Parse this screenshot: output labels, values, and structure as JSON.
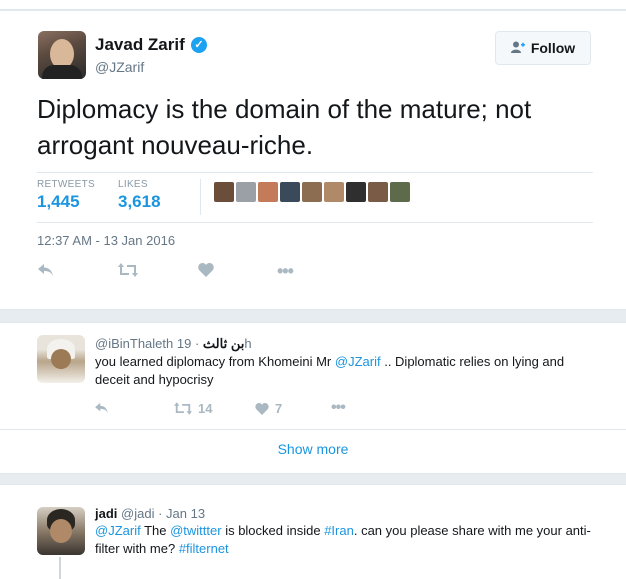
{
  "main_tweet": {
    "author_name": "Javad Zarif",
    "author_handle": "@JZarif",
    "follow_label": "Follow",
    "text": "Diplomacy is the domain of the mature; not arrogant nouveau-riche.",
    "retweets_label": "RETWEETS",
    "retweets_count": "1,445",
    "likes_label": "LIKES",
    "likes_count": "3,618",
    "timestamp": "12:37 AM - 13 Jan 2016",
    "icons": [
      "reply-icon",
      "retweet-icon",
      "like-icon",
      "more-icon",
      "verified-icon",
      "follow-person-icon"
    ]
  },
  "reply_1": {
    "handle": "@iBinThaleth",
    "arabic_name": "بن ثالث",
    "time": "· 19h",
    "text_prefix": "you learned diplomacy from Khomeini Mr ",
    "mention": "@JZarif",
    "text_suffix": " .. Diplomatic relies on lying and deceit and hypocrisy",
    "retweet_count": "14",
    "like_count": "7"
  },
  "show_more": "Show more",
  "reply_2": {
    "name": "jadi",
    "handle": "@jadi",
    "time": "· Jan 13",
    "mention_1": "@JZarif",
    "text_1": " The ",
    "mention_2": "@twittter",
    "text_2": " is blocked inside ",
    "hashtag_1": "#Iran",
    "text_3": ". can you please share with me your anti-filter with me? ",
    "hashtag_2": "#filternet"
  },
  "colors": {
    "link_blue": "#1b95e0",
    "verified_blue": "#1da1f2",
    "icon_gray": "#aab8c2",
    "text_gray": "#657786"
  }
}
